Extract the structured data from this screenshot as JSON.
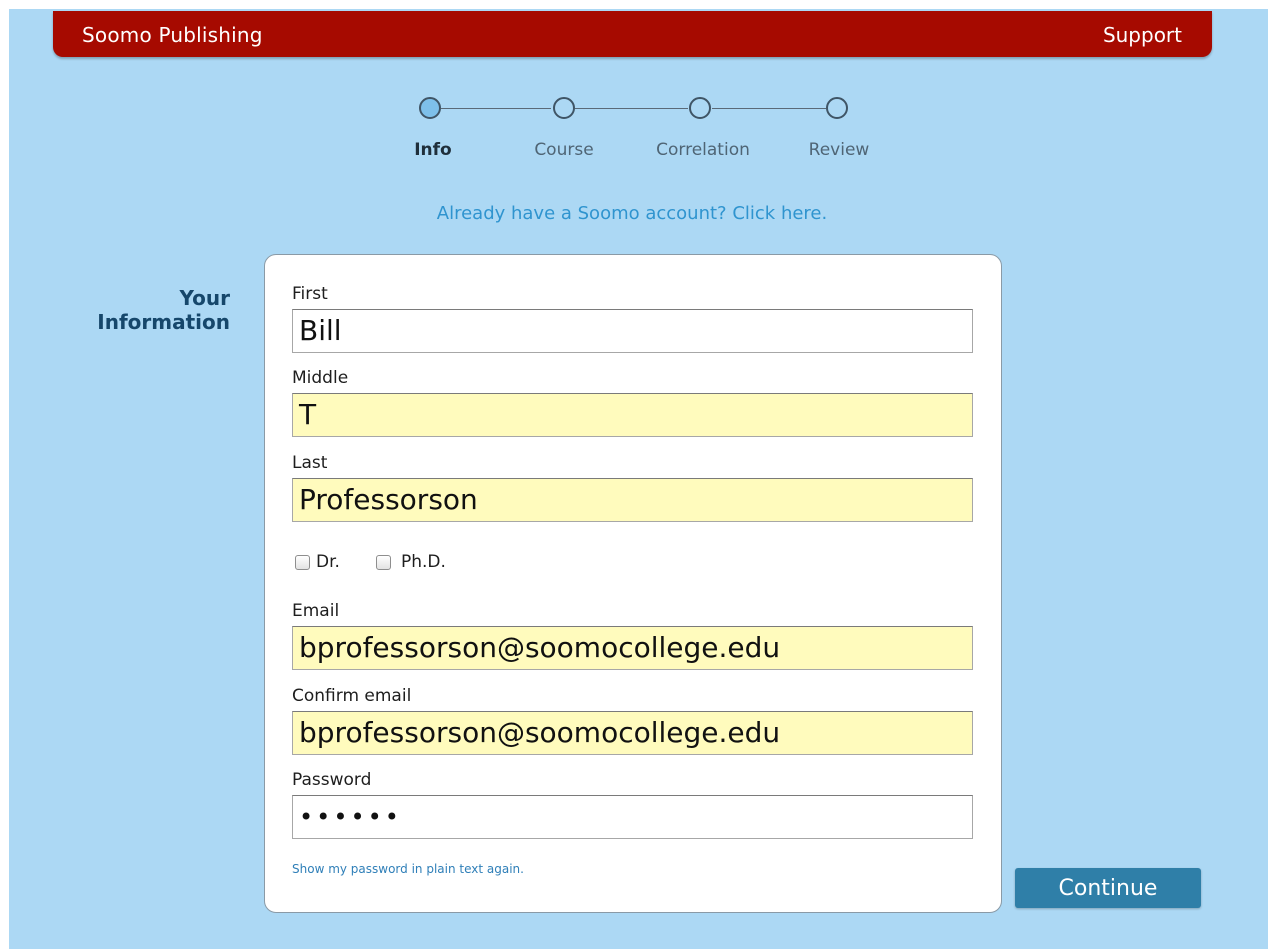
{
  "header": {
    "brand": "Soomo Publishing",
    "support_label": "Support",
    "bar_color": "#a60a00"
  },
  "stepper": {
    "steps": [
      {
        "label": "Info",
        "active": true
      },
      {
        "label": "Course",
        "active": false
      },
      {
        "label": "Correlation",
        "active": false
      },
      {
        "label": "Review",
        "active": false
      }
    ]
  },
  "account_link": "Already have a Soomo account? Click here.",
  "section_title": "Your Information",
  "form": {
    "first_label": "First",
    "first_value": "Bill",
    "middle_label": "Middle",
    "middle_value": "T",
    "last_label": "Last",
    "last_value": "Professorson",
    "dr_label": "Dr.",
    "phd_label": "Ph.D.",
    "email_label": "Email",
    "email_value": "bprofessorson@soomocollege.edu",
    "confirm_label": "Confirm email",
    "confirm_value": "bprofessorson@soomocollege.edu",
    "password_label": "Password",
    "password_value": "••••••",
    "show_password_link": "Show my password in plain text again."
  },
  "continue_label": "Continue",
  "colors": {
    "background": "#acd8f4",
    "autofill": "#fffbbd",
    "link": "#2f94cf",
    "button": "#2f7fa8"
  }
}
